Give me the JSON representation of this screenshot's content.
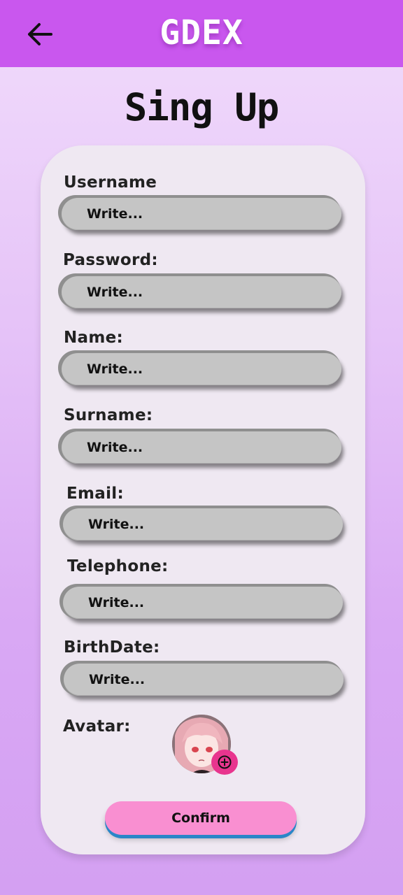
{
  "app": {
    "title": "GDEX",
    "back_icon": "arrow-left-icon",
    "header_color": "#c957ee"
  },
  "page": {
    "title": "Sing Up"
  },
  "form": {
    "fields": [
      {
        "label": "Username",
        "placeholder": "Write..."
      },
      {
        "label": "Password:",
        "placeholder": "Write..."
      },
      {
        "label": "Name:",
        "placeholder": "Write..."
      },
      {
        "label": "Surname:",
        "placeholder": "Write..."
      },
      {
        "label": "Email:",
        "placeholder": "Write..."
      },
      {
        "label": "Telephone:",
        "placeholder": "Write..."
      },
      {
        "label": "BirthDate:",
        "placeholder": "Write..."
      }
    ],
    "avatar": {
      "label": "Avatar:",
      "add_icon": "plus-circle-icon",
      "add_color": "#e8358e"
    },
    "confirm_label": "Confirm",
    "confirm_color": "#f98fd1"
  }
}
